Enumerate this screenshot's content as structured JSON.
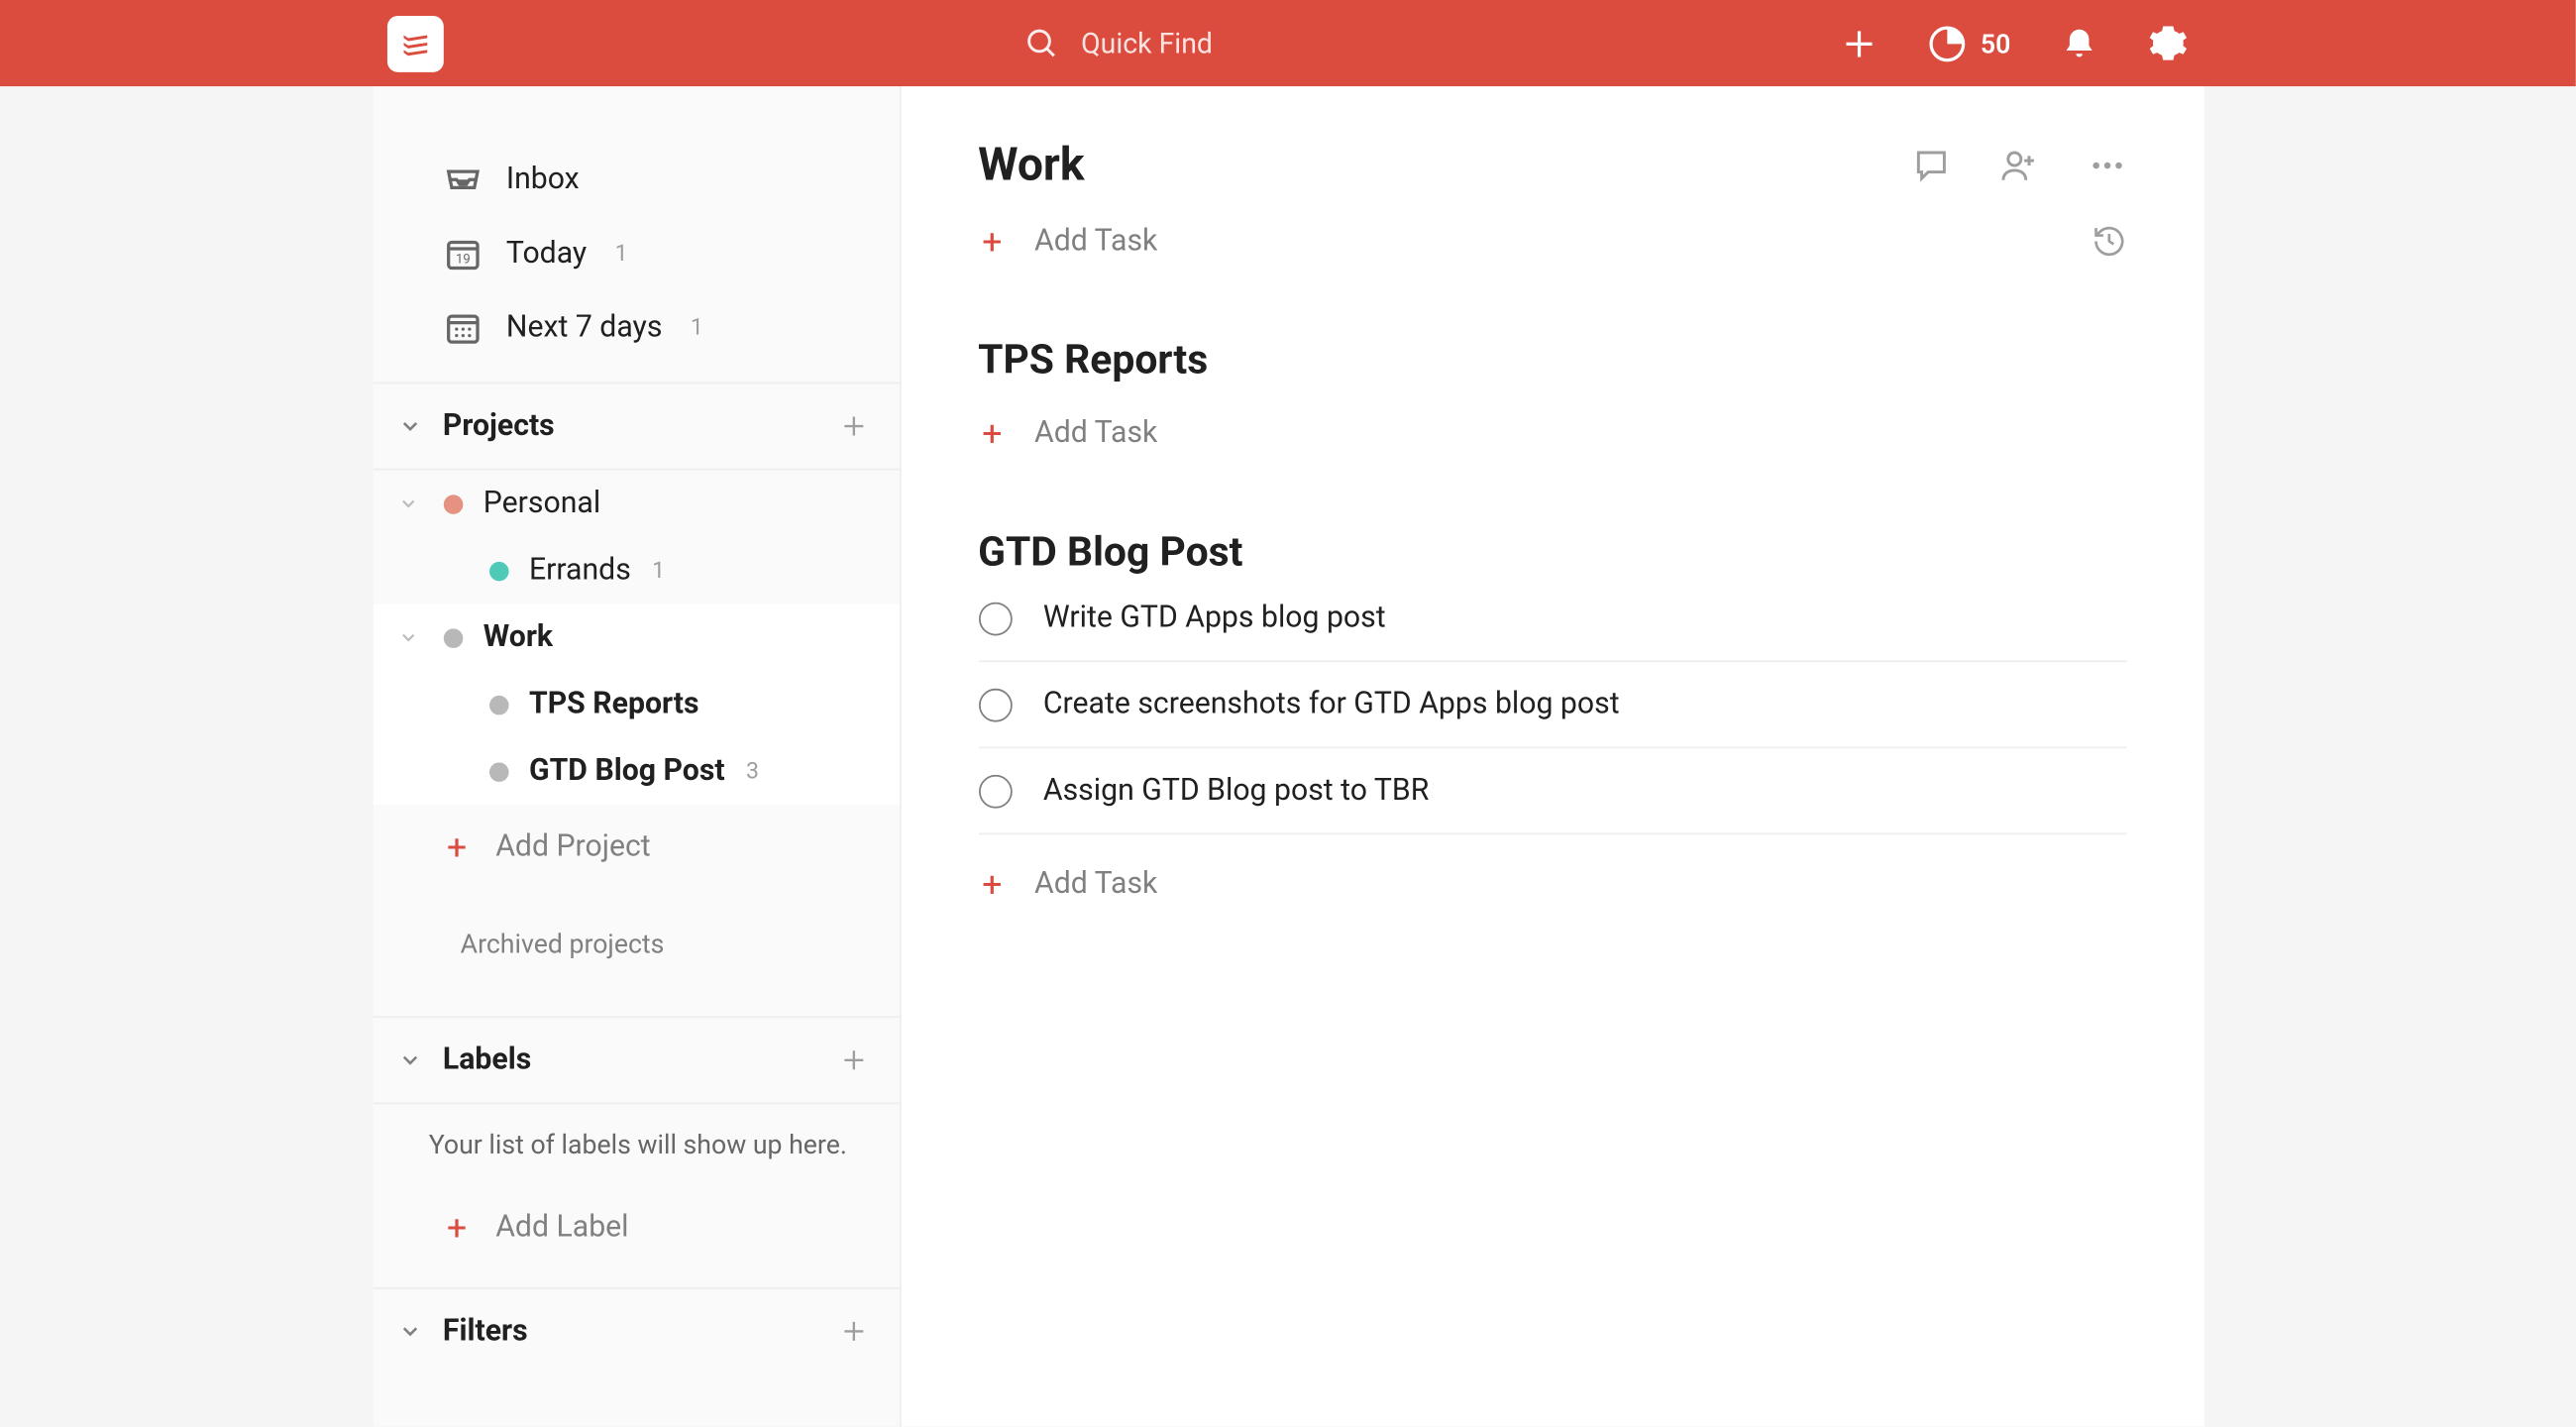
{
  "header": {
    "search_placeholder": "Quick Find",
    "karma": "50"
  },
  "sidebar": {
    "inbox": "Inbox",
    "today": "Today",
    "today_count": "1",
    "next7": "Next 7 days",
    "next7_count": "1",
    "projects_label": "Projects",
    "projects": [
      {
        "name": "Personal"
      },
      {
        "name": "Errands",
        "count": "1"
      },
      {
        "name": "Work"
      },
      {
        "name": "TPS Reports"
      },
      {
        "name": "GTD Blog Post",
        "count": "3"
      }
    ],
    "add_project": "Add Project",
    "archived": "Archived projects",
    "labels_label": "Labels",
    "labels_empty": "Your list of labels will show up here.",
    "add_label": "Add Label",
    "filters_label": "Filters"
  },
  "main": {
    "title": "Work",
    "add_task": "Add Task",
    "sections": [
      {
        "title": "TPS Reports",
        "tasks": []
      },
      {
        "title": "GTD Blog Post",
        "tasks": [
          "Write GTD Apps blog post",
          "Create screenshots for GTD Apps blog post",
          "Assign GTD Blog post to TBR"
        ]
      }
    ]
  }
}
